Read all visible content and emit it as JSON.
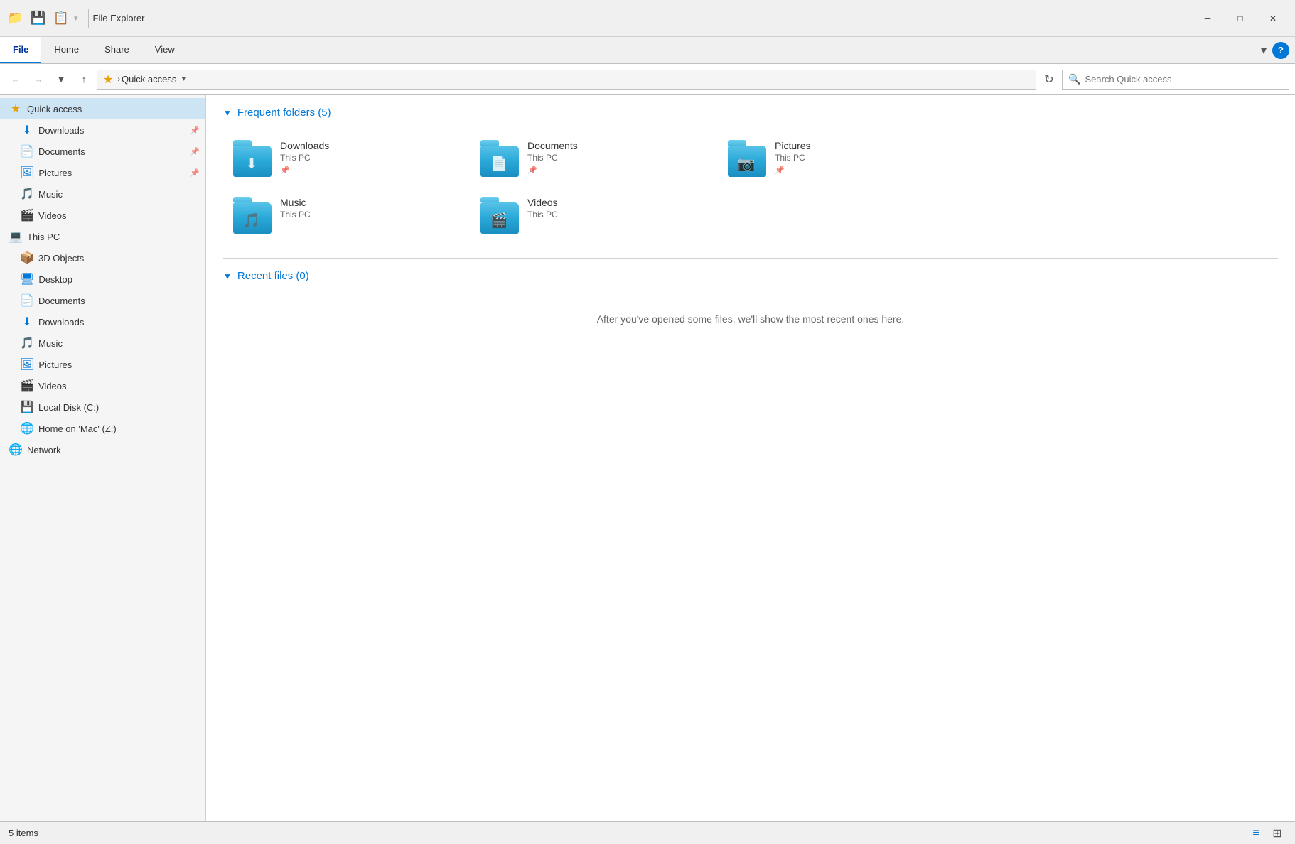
{
  "window": {
    "title": "File Explorer",
    "tabs": {
      "file": "File",
      "home": "Home",
      "share": "Share",
      "view": "View"
    },
    "active_tab": "File"
  },
  "address_bar": {
    "path": "Quick access",
    "search_placeholder": "Search Quick access",
    "refresh_symbol": "↻"
  },
  "sidebar": {
    "quick_access": {
      "label": "Quick access",
      "items": [
        {
          "label": "Downloads",
          "icon": "⬇",
          "pinned": true
        },
        {
          "label": "Documents",
          "icon": "📄",
          "pinned": true
        },
        {
          "label": "Pictures",
          "icon": "🖼",
          "pinned": true
        },
        {
          "label": "Music",
          "icon": "🎵",
          "pinned": false
        },
        {
          "label": "Videos",
          "icon": "🎬",
          "pinned": false
        }
      ]
    },
    "this_pc": {
      "label": "This PC",
      "items": [
        {
          "label": "3D Objects",
          "icon": "📦"
        },
        {
          "label": "Desktop",
          "icon": "🖥"
        },
        {
          "label": "Documents",
          "icon": "📄"
        },
        {
          "label": "Downloads",
          "icon": "⬇"
        },
        {
          "label": "Music",
          "icon": "🎵"
        },
        {
          "label": "Pictures",
          "icon": "🖼"
        },
        {
          "label": "Videos",
          "icon": "🎬"
        },
        {
          "label": "Local Disk (C:)",
          "icon": "💾"
        },
        {
          "label": "Home on 'Mac' (Z:)",
          "icon": "🌐"
        }
      ]
    },
    "network": {
      "label": "Network",
      "icon": "🌐"
    }
  },
  "content": {
    "frequent_folders": {
      "title": "Frequent folders (5)",
      "folders": [
        {
          "name": "Downloads",
          "location": "This PC",
          "icon": "⬇",
          "pinned": true
        },
        {
          "name": "Documents",
          "location": "This PC",
          "icon": "📄",
          "pinned": true
        },
        {
          "name": "Pictures",
          "location": "This PC",
          "icon": "📷",
          "pinned": true
        },
        {
          "name": "Music",
          "location": "This PC",
          "icon": "🎵",
          "pinned": false
        },
        {
          "name": "Videos",
          "location": "This PC",
          "icon": "🎬",
          "pinned": false
        }
      ]
    },
    "recent_files": {
      "title": "Recent files (0)",
      "empty_message": "After you've opened some files, we'll show the most recent ones here."
    }
  },
  "status_bar": {
    "item_count": "5 items"
  }
}
